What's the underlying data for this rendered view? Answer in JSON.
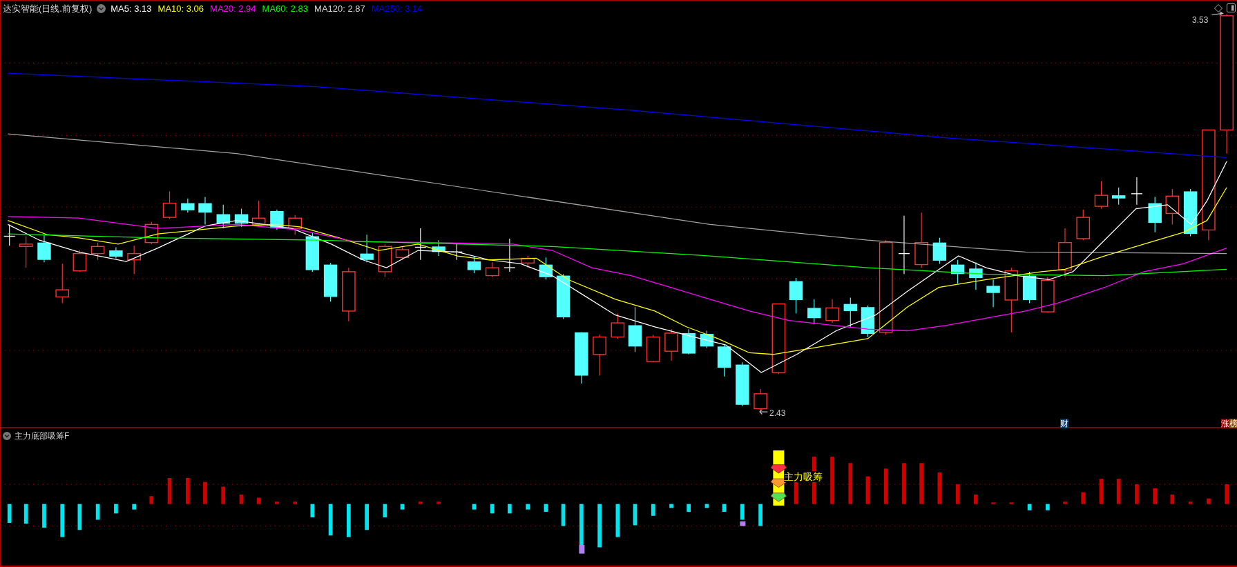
{
  "chart_header": {
    "title": "达实智能(日线.前复权)",
    "ma_legend": [
      {
        "label": "MA5: 3.13",
        "color": "#ffffff"
      },
      {
        "label": "MA10: 3.06",
        "color": "#ffff00"
      },
      {
        "label": "MA20: 2.94",
        "color": "#ff00ff"
      },
      {
        "label": "MA60: 2.83",
        "color": "#00ff00"
      },
      {
        "label": "MA120: 2.87",
        "color": "#d8d8d8"
      },
      {
        "label": "MA250: 3.14",
        "color": "#0000ff"
      }
    ]
  },
  "price_labels": {
    "high": "3.53",
    "low": "2.43"
  },
  "markers": [
    {
      "text": "财",
      "color": "#0a3a6e"
    }
  ],
  "ranking_tag": [
    {
      "text": "涨",
      "color": "#8b0000"
    },
    {
      "text": "榜",
      "color": "#8b4a00"
    }
  ],
  "indicator": {
    "title": "主力底部吸筹F",
    "signal_label": "主力吸筹"
  }
}
